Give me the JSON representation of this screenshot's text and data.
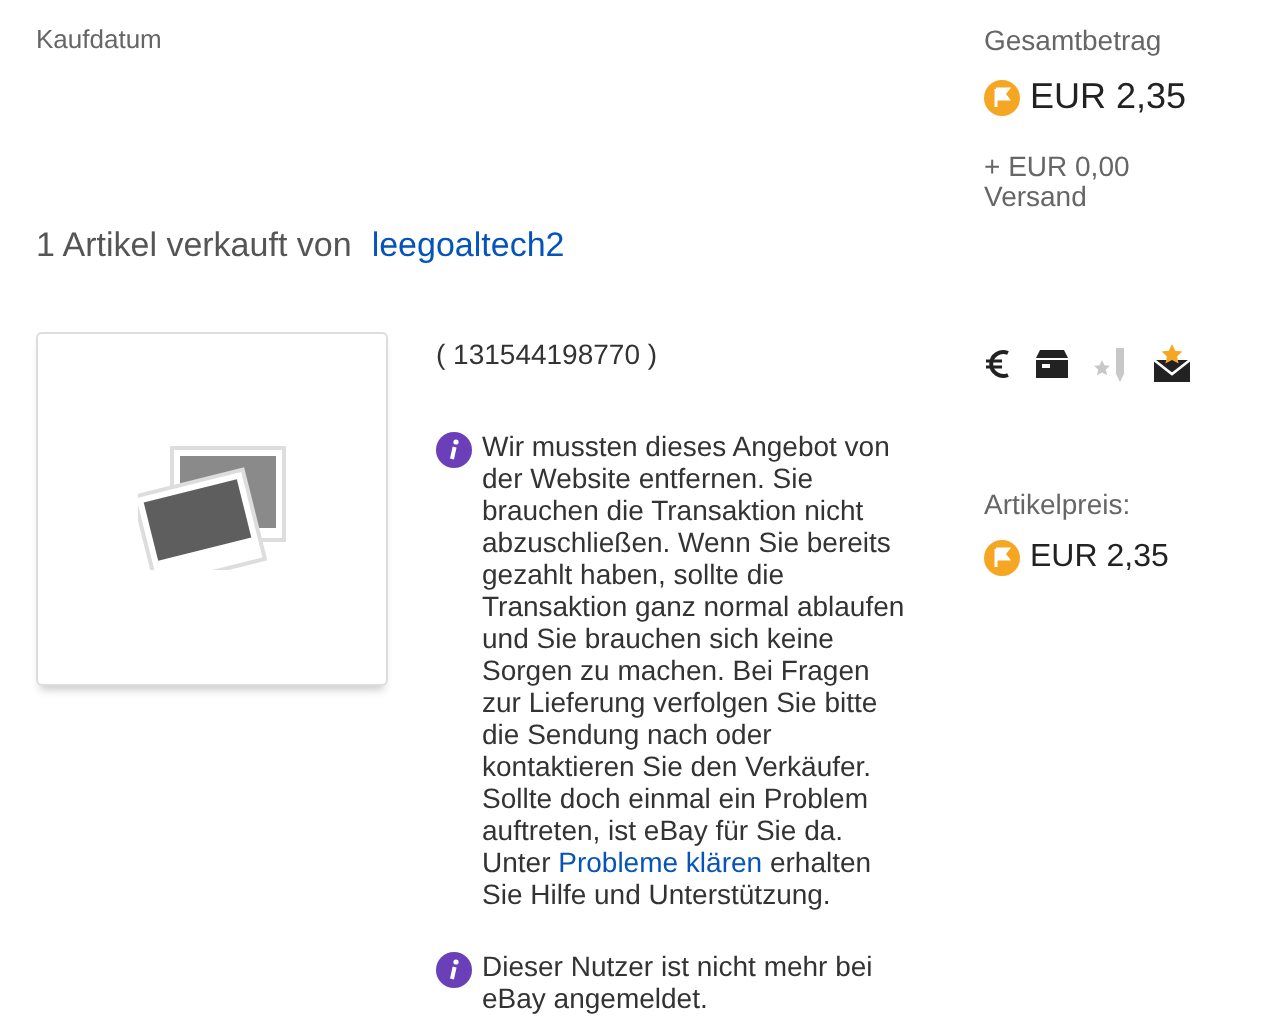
{
  "purchase_date_label": "Kaufdatum",
  "total": {
    "label": "Gesamtbetrag",
    "amount": "EUR 2,35",
    "shipping": "+ EUR 0,00",
    "shipping_label": "Versand"
  },
  "heading": {
    "text": "1 Artikel verkauft von",
    "seller": "leegoaltech2"
  },
  "item": {
    "image": {
      "kind": "placeholder"
    },
    "number": "( 131544198770 )",
    "notices": [
      {
        "before": "Wir mussten dieses Angebot von der Website entfernen. Sie brauchen die Transaktion nicht abzuschließen. Wenn Sie bereits gezahlt haben, sollte die Transaktion ganz normal ablaufen und Sie brauchen sich keine Sorgen zu machen. Bei Fragen zur Lieferung verfolgen Sie bitte die Sendung nach oder kontaktieren Sie den Verkäufer. Sollte doch einmal ein Problem auftreten, ist eBay für Sie da. Unter",
        "link": "Probleme klären",
        "after": "erhalten Sie Hilfe und Unterstützung."
      },
      {
        "before": "Dieser Nutzer ist nicht mehr bei eBay angemeldet."
      }
    ]
  },
  "status_icons": [
    {
      "kind": "paid",
      "active": true
    },
    {
      "kind": "shipped",
      "active": true
    },
    {
      "kind": "feedback_left",
      "active": false
    },
    {
      "kind": "feedback_received",
      "active": true
    }
  ],
  "item_price": {
    "label": "Artikelpreis:",
    "amount": "EUR 2,35"
  }
}
